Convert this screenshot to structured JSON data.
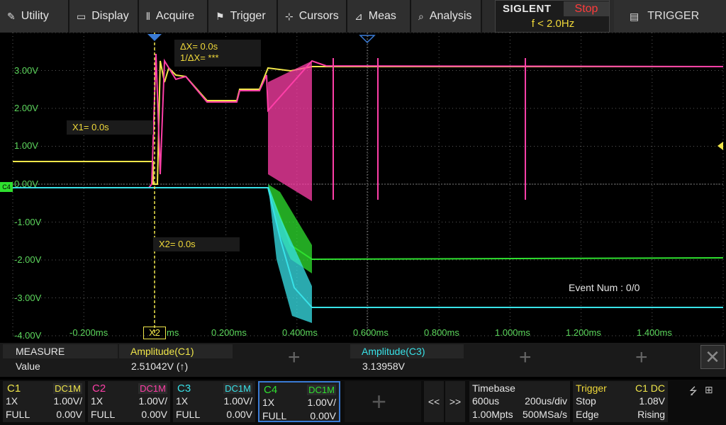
{
  "menu": {
    "items": [
      {
        "label": "Utility",
        "icon": "wrench-icon",
        "glyph": "✎"
      },
      {
        "label": "Display",
        "icon": "monitor-icon",
        "glyph": "▭"
      },
      {
        "label": "Acquire",
        "icon": "acquire-icon",
        "glyph": "⫴"
      },
      {
        "label": "Trigger",
        "icon": "flag-icon",
        "glyph": "⚑"
      },
      {
        "label": "Cursors",
        "icon": "cursor-cross-icon",
        "glyph": "⊹"
      },
      {
        "label": "Meas",
        "icon": "ruler-icon",
        "glyph": "⊿"
      },
      {
        "label": "Analysis",
        "icon": "analysis-icon",
        "glyph": "⌕"
      }
    ],
    "brand": "SIGLENT",
    "run_state": "Stop",
    "trigger_freq": "f < 2.0Hz",
    "right_menu": "TRIGGER",
    "right_menu_icon": "list-icon"
  },
  "screen": {
    "volt_labels": [
      "3.00V",
      "2.00V",
      "1.00V",
      "0.00V",
      "-1.00V",
      "-2.00V",
      "-3.00V",
      "-4.00V"
    ],
    "time_labels": [
      "-0.200ms",
      "0.200ms",
      "0.400ms",
      "0.600ms",
      "0.800ms",
      "1.000ms",
      "1.200ms",
      "1.400ms"
    ],
    "x2_marker": "X2",
    "x2_unit": "ms",
    "delta_x": "ΔX= 0.0s",
    "inv_delta_x": "1/ΔX= ***",
    "x1": "X1= 0.0s",
    "x2": "X2= 0.0s",
    "ch4_marker": "C4",
    "event_num": "Event Num : 0/0",
    "colors": {
      "c1": "#f0e64a",
      "c2": "#ff3fa8",
      "c3": "#38e2e8",
      "c4": "#2fe02f",
      "grid": "#5a5a5a",
      "axis_text": "#5cd65c"
    }
  },
  "measure": {
    "title": "MEASURE",
    "value_label": "Value",
    "m1_name": "Amplitude(C1)",
    "m1_value": "2.51042V",
    "m1_arrow": "(↑)",
    "m2_name": "Amplitude(C3)",
    "m2_value": "3.13958V",
    "close": "✕"
  },
  "channels": [
    {
      "name": "C1",
      "coupling": "DC1M",
      "probe": "1X",
      "scale": "1.00V/",
      "bw": "FULL",
      "offset": "0.00V",
      "color": "#f0e64a"
    },
    {
      "name": "C2",
      "coupling": "DC1M",
      "probe": "1X",
      "scale": "1.00V/",
      "bw": "FULL",
      "offset": "0.00V",
      "color": "#ff3fa8"
    },
    {
      "name": "C3",
      "coupling": "DC1M",
      "probe": "1X",
      "scale": "1.00V/",
      "bw": "FULL",
      "offset": "0.00V",
      "color": "#38e2e8"
    },
    {
      "name": "C4",
      "coupling": "DC1M",
      "probe": "1X",
      "scale": "1.00V/",
      "bw": "FULL",
      "offset": "0.00V",
      "color": "#2fe02f"
    }
  ],
  "nav": {
    "prev": "<<",
    "next": ">>"
  },
  "timebase": {
    "title": "Timebase",
    "delay": "600us",
    "scale": "200us/div",
    "memory": "1.00Mpts",
    "rate": "500MSa/s"
  },
  "trigger": {
    "title": "Trigger",
    "source": "C1 DC",
    "mode": "Stop",
    "level": "1.08V",
    "type": "Edge",
    "slope": "Rising"
  },
  "status_icons": [
    "usb-icon",
    "network-icon"
  ]
}
